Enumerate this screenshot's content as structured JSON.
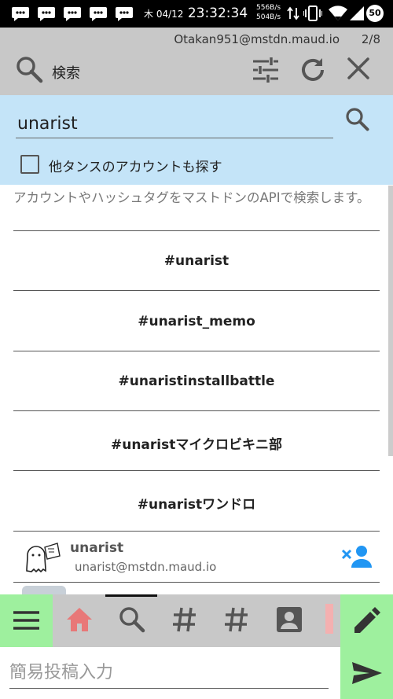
{
  "status_bar": {
    "date": "木 04/12",
    "time": "23:32:34",
    "rate_up": "556B/s",
    "rate_down": "504B/s",
    "battery": "50"
  },
  "column_header": {
    "account": "Otakan951@mstdn.maud.io",
    "page": "2/8",
    "title": "検索"
  },
  "search": {
    "query": "unarist",
    "other_instances_label": "他タンスのアカウントも探す",
    "other_instances_checked": false
  },
  "hint": "アカウントやハッシュタグをマストドンのAPIで検索します。",
  "hashtags": [
    "#unarist",
    "#unarist_memo",
    "#unaristinstallbattle",
    "#unaristマイクロビキニ部",
    "#unaristワンドロ"
  ],
  "account_result": {
    "display_name": "unarist",
    "handle": "unarist@mstdn.maud.io"
  },
  "post": {
    "placeholder": "簡易投稿入力"
  },
  "colors": {
    "header_bg": "#c8c8c8",
    "search_panel_bg": "#c4e4f8",
    "accent_green": "#9ef09e",
    "home_icon": "#e87878",
    "follow_icon": "#2196f3"
  },
  "icons": {
    "bottom_columns": [
      "home-icon",
      "search-icon",
      "hashtag-icon",
      "hashtag-icon",
      "profile-icon"
    ]
  }
}
